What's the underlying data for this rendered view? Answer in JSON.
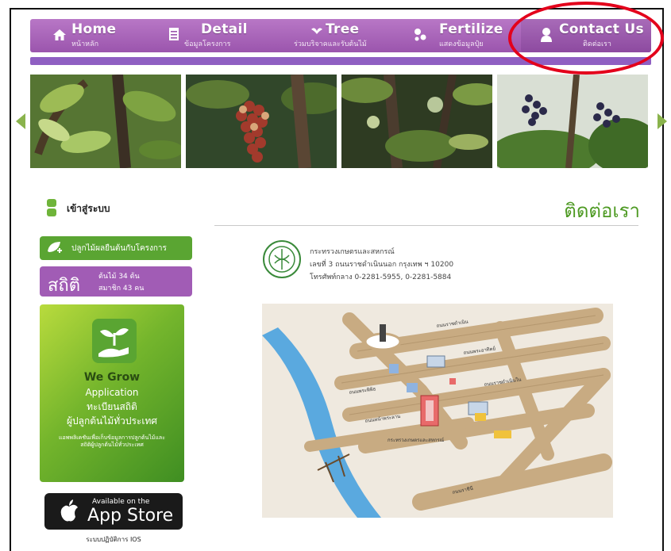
{
  "nav": {
    "items": [
      {
        "en": "Home",
        "th": "หน้าหลัก",
        "icon": "home-icon"
      },
      {
        "en": "Detail",
        "th": "ข้อมูลโครงการ",
        "icon": "document-icon"
      },
      {
        "en": "Tree",
        "th": "ร่วมบริจาคและรับต้นไม้",
        "icon": "tree-icon"
      },
      {
        "en": "Fertilize",
        "th": "แสดงข้อมูลปุ๋ย",
        "icon": "fertilize-icon"
      },
      {
        "en": "Contact Us",
        "th": "ติดต่อเรา",
        "icon": "person-icon"
      }
    ]
  },
  "sidebar": {
    "login_label": "เข้าสู่ระบบ",
    "plant_button": "ปลูกไม้ผลยืนต้นกับโครงการ",
    "stats": {
      "title": "สถิติ",
      "trees": "ต้นไม้ 34 ต้น",
      "members": "สมาชิก 43 คน"
    },
    "wegrow": {
      "title": "We Grow",
      "subtitle": "Application",
      "line1": "ทะเบียนสถิติ",
      "line2": "ผู้ปลูกต้นไม้ทั่วประเทศ",
      "small": "แอพพลิเคชันเพื่อเก็บข้อมูลการปลูกต้นไม้และสถิติผู้ปลูกต้นไม้ทั่วประเทศ"
    },
    "appstore": {
      "small": "Available on the",
      "big": "App Store",
      "caption": "ระบบปฏิบัติการ IOS"
    }
  },
  "content": {
    "title": "ติดต่อเรา",
    "org": "กระทรวงเกษตรและสหกรณ์",
    "address": "เลขที่ 3 ถนนราชดำเนินนอก กรุงเทพ ฯ 10200",
    "phone": "โทรศัพท์กลาง 0-2281-5955, 0-2281-5884"
  },
  "map": {
    "labels": [
      "ถนนราชดำเนิน",
      "ถนนพระอาทิตย์",
      "ถนนราชดำเนินใน",
      "ถนนพระพิพิธ",
      "ถนนหน้าพระลาน",
      "กระทรวงเกษตรและสหกรณ์",
      "ถนนราชินี"
    ]
  },
  "colors": {
    "purple": "#9b55ad",
    "green": "#5aa532",
    "accent": "#4e9a23",
    "circle": "#e3001b"
  }
}
